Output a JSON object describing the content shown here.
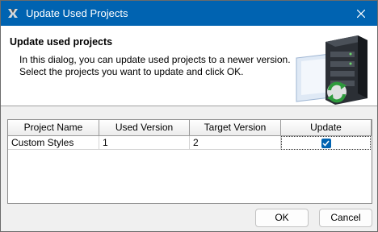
{
  "window": {
    "title": "Update Used Projects"
  },
  "header": {
    "title": "Update used projects",
    "line1": "In this dialog, you can update used projects to a newer version.",
    "line2": "Select the projects you want to update and click OK."
  },
  "table": {
    "columns": [
      "Project Name",
      "Used Version",
      "Target Version",
      "Update"
    ],
    "rows": [
      {
        "project_name": "Custom Styles",
        "used_version": "1",
        "target_version": "2",
        "update": true
      }
    ]
  },
  "buttons": {
    "ok": "OK",
    "cancel": "Cancel"
  },
  "icons": {
    "app": "app-logo-icon",
    "close": "close-icon",
    "server": "server-update-icon",
    "check": "checkmark-icon"
  },
  "colors": {
    "titlebar": "#0063b1",
    "accent": "#0063b1",
    "sync_arrow": "#2e9a3c"
  }
}
